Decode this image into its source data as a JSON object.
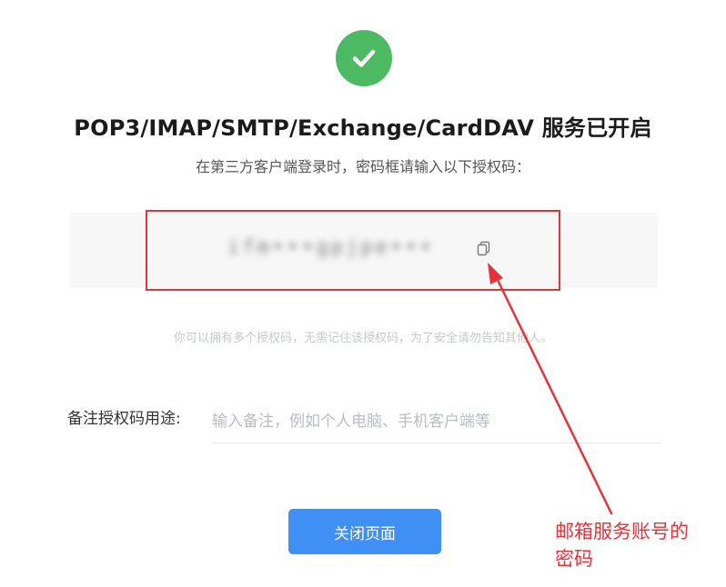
{
  "page": {
    "title": "POP3/IMAP/SMTP/Exchange/CardDAV 服务已开启",
    "subtitle": "在第三方客户端登录时，密码框请输入以下授权码：",
    "auth_code_masked": "ifm•••gpjpe•••",
    "hint": "你可以拥有多个授权码，无需记住该授权码，为了安全请勿告知其他人。"
  },
  "remark": {
    "label": "备注授权码用途:",
    "placeholder": "输入备注，例如个人电脑、手机客户端等",
    "value": ""
  },
  "actions": {
    "close_label": "关闭页面"
  },
  "annotation": {
    "line1": "邮箱服务账号的",
    "line2": "密码"
  },
  "colors": {
    "success": "#4cb963",
    "primary": "#3f8ff5",
    "annotation": "#e5333a"
  },
  "icons": {
    "success": "check-circle-icon",
    "copy": "copy-icon"
  }
}
